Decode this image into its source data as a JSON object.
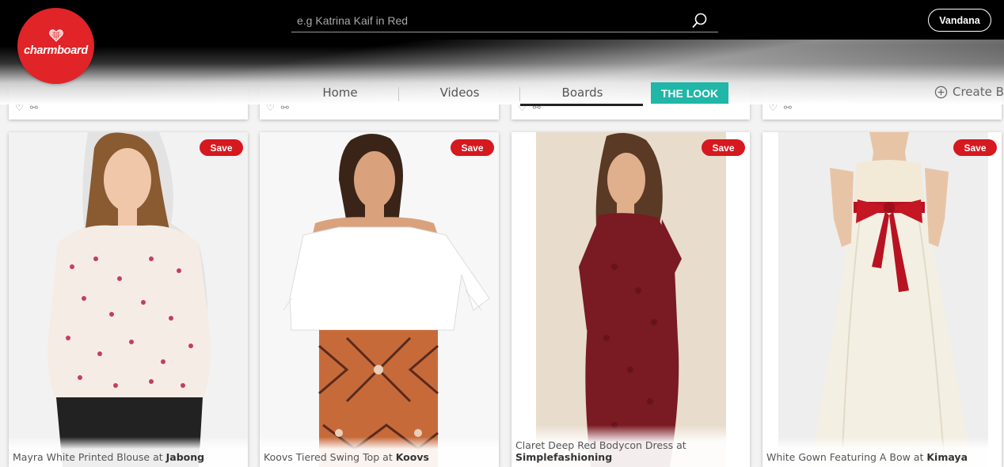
{
  "header": {
    "logo_text": "charmboard",
    "search_placeholder": "e.g Katrina Kaif in Red",
    "user_name": "Vandana",
    "nav": [
      {
        "label": "Home"
      },
      {
        "label": "Videos"
      },
      {
        "label": "Boards"
      },
      {
        "label": "THE LOOK"
      }
    ],
    "create_label": "Create B"
  },
  "products": [
    {
      "title": "Mayra White Printed Blouse at ",
      "store": "Jabong",
      "save_label": "Save"
    },
    {
      "title": "Koovs Tiered Swing Top at ",
      "store": "Koovs",
      "save_label": "Save"
    },
    {
      "title": "Claret Deep Red Bodycon Dress at ",
      "store": "Simplefashioning",
      "save_label": "Save"
    },
    {
      "title": "White Gown Featuring A Bow at ",
      "store": "Kimaya",
      "save_label": "Save"
    }
  ],
  "colors": {
    "brand_red": "#e02428",
    "save_red": "#d6181f",
    "accent_teal": "#20b6a8",
    "header_black": "#000000"
  }
}
